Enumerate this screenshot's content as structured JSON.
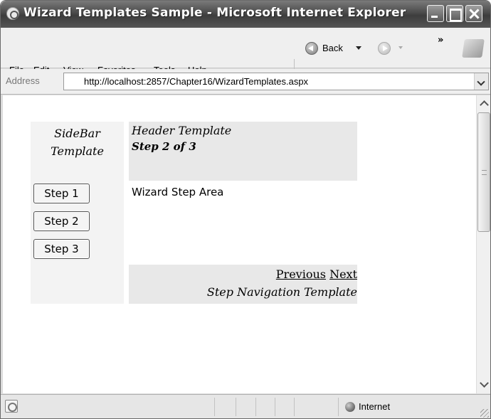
{
  "window": {
    "title": "Wizard Templates Sample - Microsoft Internet Explorer"
  },
  "menu": {
    "file": "File",
    "edit": "Edit",
    "view": "View",
    "favorites": "Favorites",
    "tools": "Tools",
    "help": "Help"
  },
  "toolbar": {
    "back_label": "Back",
    "overflow": "»"
  },
  "address": {
    "label": "Address",
    "url": "http://localhost:2857/Chapter16/WizardTemplates.aspx"
  },
  "wizard": {
    "sidebar_title": "SideBar Template",
    "steps": [
      "Step 1",
      "Step 2",
      "Step 3"
    ],
    "header_template": "Header Template",
    "header_step": "Step 2 of 3",
    "step_area": "Wizard Step Area",
    "nav_previous": "Previous",
    "nav_next": "Next",
    "nav_template": "Step Navigation Template"
  },
  "status": {
    "zone": "Internet"
  },
  "icons": [
    "ie-logo-icon",
    "minimize-icon",
    "maximize-icon",
    "close-icon",
    "back-arrow-icon",
    "forward-arrow-icon",
    "windows-logo-icon",
    "page-icon",
    "globe-icon"
  ]
}
